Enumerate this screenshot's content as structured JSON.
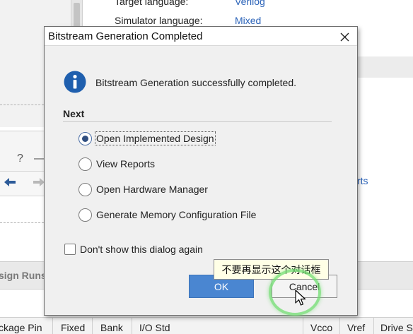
{
  "background": {
    "properties": [
      {
        "label": "Target language:",
        "value": "Verilog"
      },
      {
        "label": "Simulator language:",
        "value": "Mixed"
      }
    ],
    "help_glyph": "?",
    "minimize_glyph": "—",
    "reports_link_fragment": "rts",
    "design_runs_tab": "sign Runs",
    "io_columns": [
      "ckage Pin",
      "Fixed",
      "Bank",
      "I/O Std",
      "Vcco",
      "Vref",
      "Drive S"
    ]
  },
  "dialog": {
    "title": "Bitstream Generation Completed",
    "message": "Bitstream Generation successfully completed.",
    "section_heading": "Next",
    "options": [
      {
        "label": "Open Implemented Design",
        "checked": true
      },
      {
        "label": "View Reports",
        "checked": false
      },
      {
        "label": "Open Hardware Manager",
        "checked": false
      },
      {
        "label": "Generate Memory Configuration File",
        "checked": false
      }
    ],
    "dont_show_label": "Don't show this dialog again",
    "dont_show_checked": false,
    "ok_label": "OK",
    "cancel_label": "Cancel"
  },
  "tooltip": {
    "text": "不要再显示这个对话框"
  },
  "icons": {
    "info": "info-icon",
    "close": "close-icon",
    "cursor": "mouse-pointer-icon",
    "back": "arrow-left-icon",
    "forward": "arrow-right-icon"
  },
  "colors": {
    "ok_button": "#4a86d1",
    "link": "#2a62b8",
    "info_icon": "#1f5fae",
    "highlight_ring": "#70de70",
    "tooltip_bg": "#ffffe6"
  }
}
